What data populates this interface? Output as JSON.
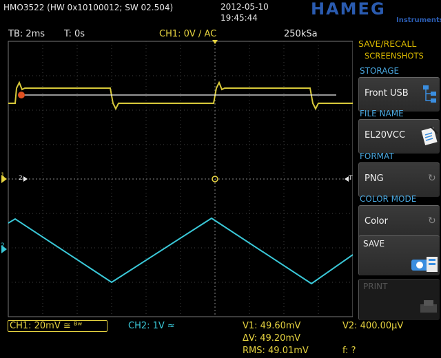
{
  "header": {
    "device_info": "HMO3522 (HW 0x10100012; SW 02.504)",
    "date": "2012-05-10",
    "time": "19:45:44",
    "brand": "HAMEG",
    "brand_sub": "Instruments"
  },
  "status": {
    "timebase": "TB: 2ms",
    "trigger_time": "T: 0s",
    "ch1_trigger": "CH1: 0V ∕ AC",
    "sample_rate": "250kSa"
  },
  "markers": {
    "ch1_left": "1",
    "ch2_left": "2",
    "ch2_ref": "2",
    "trig_right": "T"
  },
  "menu": {
    "title": "SAVE/RECALL",
    "subtitle": "SCREENSHOTS",
    "storage_label": "STORAGE",
    "storage_value": "Front USB",
    "file_name_label": "FILE NAME",
    "file_name_value": "EL20VCC",
    "format_label": "FORMAT",
    "format_value": "PNG",
    "color_mode_label": "COLOR MODE",
    "color_mode_value": "Color",
    "save_label": "SAVE",
    "print_label": "PRINT"
  },
  "bottom": {
    "ch1_scale": "CH1: 20mV ≅ ᴮʷ",
    "ch2_scale": "CH2: 1V ≈",
    "v1": "V1: 49.60mV",
    "v2": "V2: 400.00µV",
    "dv": "ΔV: 49.20mV",
    "rms": "RMS: 49.01mV",
    "freq": "f: ?"
  },
  "colors": {
    "ch1": "#e6d340",
    "ch2": "#3ac8d8",
    "accent_menu": "#d9b800",
    "menu_blue": "#4aa8e0",
    "brand": "#2a5bb0"
  }
}
